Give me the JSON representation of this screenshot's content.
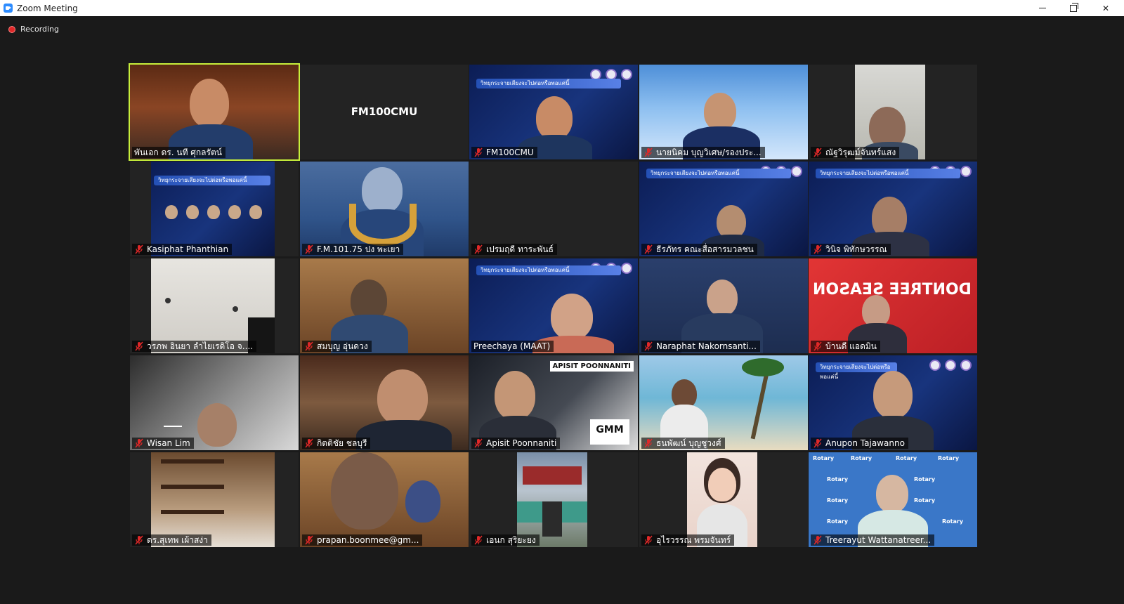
{
  "window": {
    "title": "Zoom Meeting"
  },
  "recording": {
    "label": "Recording"
  },
  "gallery": {
    "tiles": [
      {
        "name": "พันเอก ดร. นที ศุกลรัตน์",
        "muted": false,
        "active": true,
        "video": true
      },
      {
        "name": "FM100CMU",
        "muted": false,
        "active": false,
        "video": false
      },
      {
        "name": "FM100CMU",
        "muted": true,
        "active": false,
        "video": true
      },
      {
        "name": "นายนิคม บุญวิเศษ/รองประ...",
        "muted": true,
        "active": false,
        "video": true
      },
      {
        "name": "ณัฐวิรุฒม์จันทร์แสง",
        "muted": true,
        "active": false,
        "video": true
      },
      {
        "name": "Kasiphat Phanthian",
        "muted": true,
        "active": false,
        "video": true
      },
      {
        "name": "F.M.101.75 ปง พะเยา",
        "muted": true,
        "active": false,
        "video": true
      },
      {
        "name": "เปรมฤดี ทาระพันธ์",
        "muted": true,
        "active": false,
        "video": false
      },
      {
        "name": "ธีรภัทร คณะสื่อสารมวลชน",
        "muted": true,
        "active": false,
        "video": true
      },
      {
        "name": "วินิจ พิทักษวรรณ",
        "muted": true,
        "active": false,
        "video": true
      },
      {
        "name": "วรภพ อินยา ลำไยเรดิโอ จ....",
        "muted": true,
        "active": false,
        "video": true
      },
      {
        "name": "สมบุญ อุ่นดวง",
        "muted": true,
        "active": false,
        "video": true
      },
      {
        "name": "Preechaya (MAAT)",
        "muted": false,
        "active": false,
        "video": true
      },
      {
        "name": "Naraphat Nakornsanti...",
        "muted": true,
        "active": false,
        "video": true
      },
      {
        "name": "บ้านดี แอดมิน",
        "muted": true,
        "active": false,
        "video": true
      },
      {
        "name": "Wisan Lim",
        "muted": true,
        "active": false,
        "video": true
      },
      {
        "name": "กิตติชัย ชลบุรี",
        "muted": true,
        "active": false,
        "video": true
      },
      {
        "name": "Apisit Poonnaniti",
        "muted": true,
        "active": false,
        "video": true
      },
      {
        "name": "ธนพัฒน์ บุญชูวงศ์",
        "muted": true,
        "active": false,
        "video": true
      },
      {
        "name": "Anupon Tajawanno",
        "muted": true,
        "active": false,
        "video": true
      },
      {
        "name": "ดร.สุเทพ เผ้าสง่า",
        "muted": true,
        "active": false,
        "video": true
      },
      {
        "name": "prapan.boonmee@gm...",
        "muted": true,
        "active": false,
        "video": true
      },
      {
        "name": "เอนก สุริยะยง",
        "muted": true,
        "active": false,
        "video": true
      },
      {
        "name": "อุไรวรรณ พรมจันทร์",
        "muted": true,
        "active": false,
        "video": true
      },
      {
        "name": "Treerayut Wattanatreer...",
        "muted": true,
        "active": false,
        "video": true
      }
    ]
  },
  "posters": {
    "radio_title": "วิทยุกระจายเสียงจะไปต่อหรือพอแค่นี้",
    "apisit_banner": "APISIT POONNANITI",
    "gmm_badge": "GMM",
    "red_text": "DONTREE SEASON",
    "rotary": "Rotary"
  },
  "colors": {
    "active_outline": "#c7ef3b",
    "muted_icon": "#e02828",
    "recording_dot": "#e02828"
  }
}
